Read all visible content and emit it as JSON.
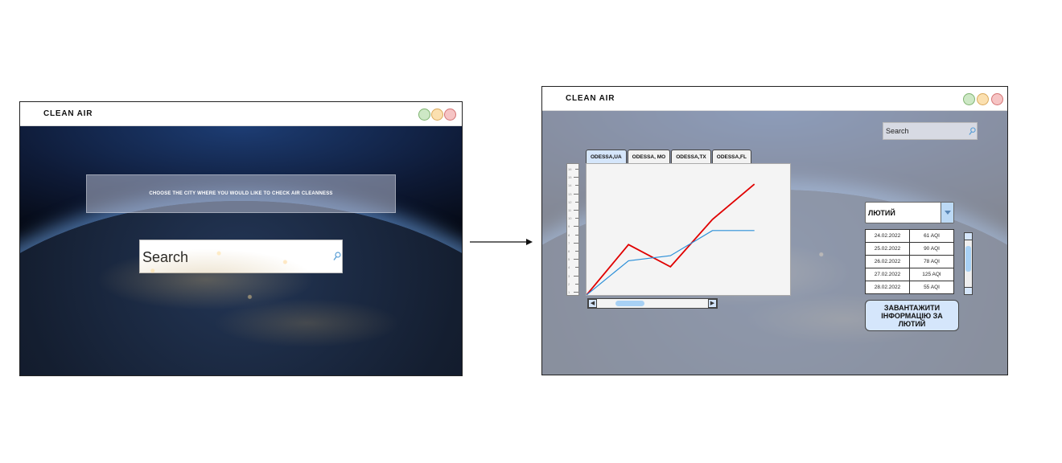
{
  "app_title": "CLEAN AIR",
  "screen1": {
    "prompt": "CHOOSE THE CITY WHERE YOU WOULD LIKE TO CHECK AIR CLEANNESS",
    "search_placeholder": "Search"
  },
  "screen2": {
    "search_placeholder": "Search",
    "tabs": [
      {
        "label": "ODESSA,UA",
        "active": true
      },
      {
        "label": "ODESSA, MO",
        "active": false
      },
      {
        "label": "ODESSA,TX",
        "active": false
      },
      {
        "label": "ODESSA,FL",
        "active": false
      }
    ],
    "ruler_labels": [
      "1",
      "2",
      "3",
      "4",
      "5",
      "6",
      "7",
      "8",
      "9",
      "10",
      "11",
      "12",
      "13",
      "14",
      "15",
      "16"
    ],
    "month": "ЛЮТИЙ",
    "aqi_rows": [
      {
        "date": "24.02.2022",
        "value": "61 AQI"
      },
      {
        "date": "25.02.2022",
        "value": "90 AQI"
      },
      {
        "date": "26.02.2022",
        "value": "78 AQI"
      },
      {
        "date": "27.02.2022",
        "value": "125 AQI"
      },
      {
        "date": "28.02.2022",
        "value": "55 AQI"
      }
    ],
    "load_button": "ЗАВАНТАЖИТИ ІНФОРМАЦІЮ ЗА ЛЮТИЙ"
  },
  "chart_data": {
    "type": "line",
    "x": [
      0,
      1,
      2,
      3,
      4
    ],
    "series": [
      {
        "values": [
          0,
          50,
          28,
          75,
          110
        ],
        "color": "#e00000"
      },
      {
        "values": [
          0,
          34,
          39,
          64,
          64
        ],
        "color": "#2b8fd8"
      }
    ],
    "xlim": [
      0,
      4.85
    ],
    "ylim": [
      0,
      130
    ],
    "grid": false
  },
  "colors": {
    "accent": "#d5e6fb",
    "series_red": "#e00000",
    "series_blue": "#2b8fd8"
  }
}
